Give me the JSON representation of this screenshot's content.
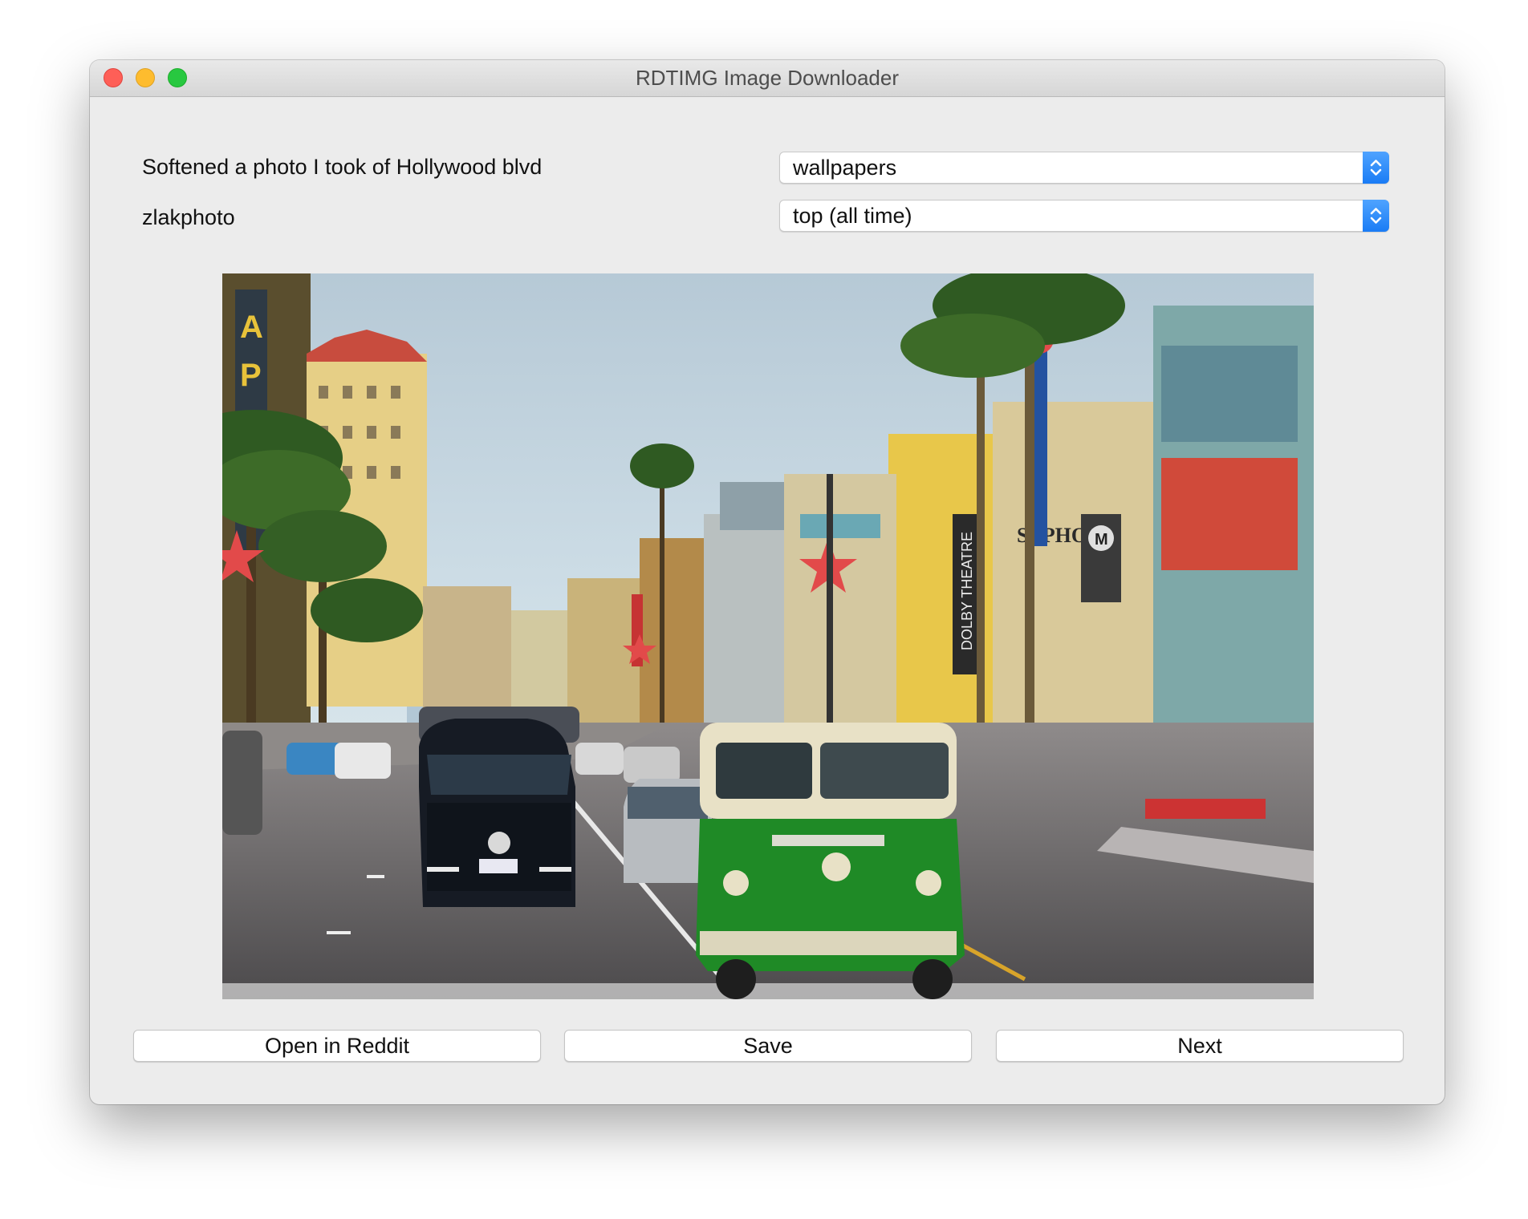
{
  "window": {
    "title": "RDTIMG Image Downloader"
  },
  "post": {
    "title": "Softened a photo I took of Hollywood blvd",
    "author": "zlakphoto"
  },
  "controls": {
    "subreddit": {
      "value": "wallpapers"
    },
    "sort": {
      "value": "top (all time)"
    }
  },
  "buttons": {
    "open": "Open in Reddit",
    "save": "Save",
    "next": "Next"
  },
  "colors": {
    "accent": "#1a7cf5",
    "close": "#fe5f57",
    "minimize": "#febc2e",
    "maximize": "#28c840",
    "van_green": "#1f8a26"
  },
  "icons": {
    "stepper": "up-down-chevrons-icon"
  }
}
